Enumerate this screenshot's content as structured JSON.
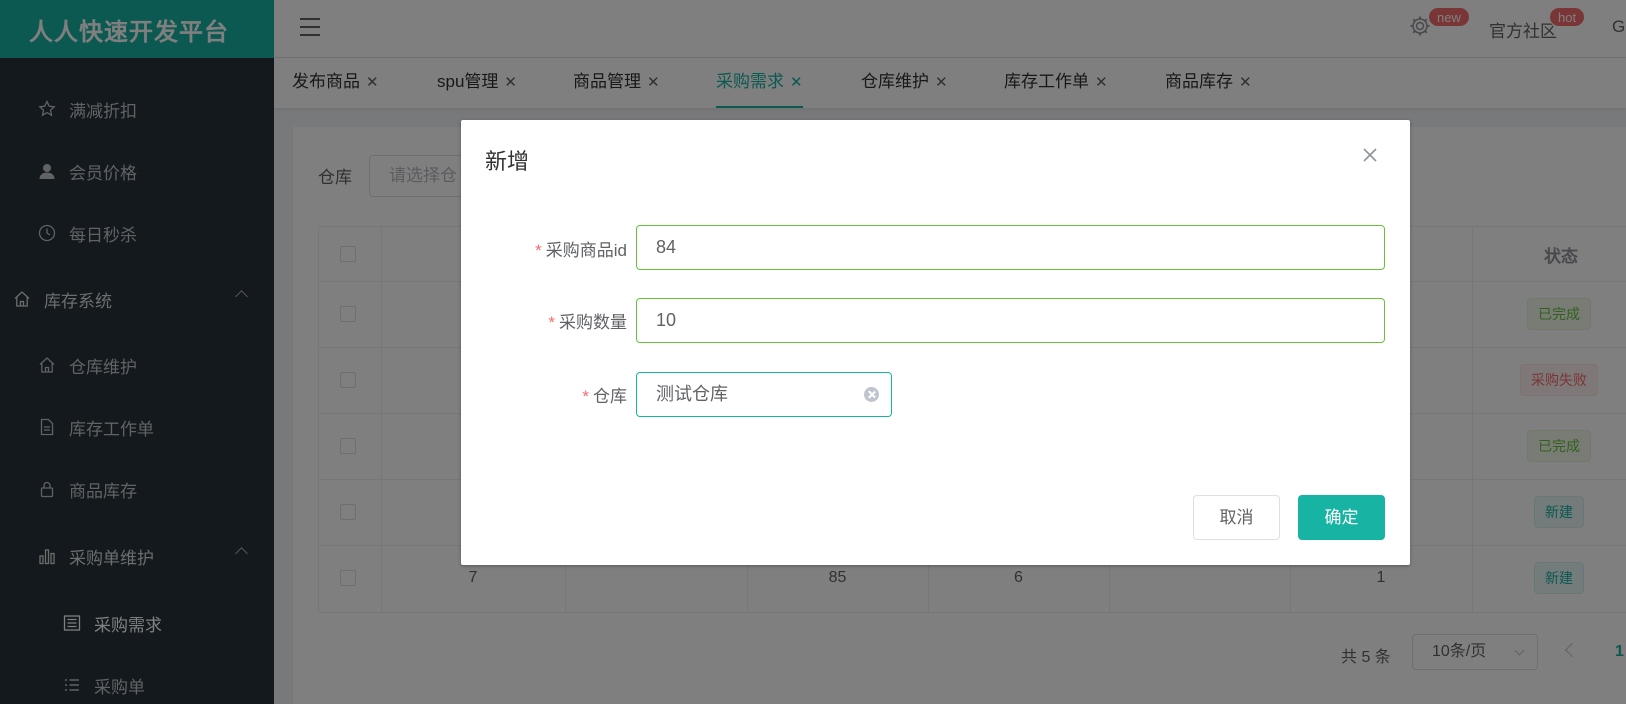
{
  "sidebar": {
    "brand": "人人快速开发平台",
    "items": [
      {
        "label": "满减折扣",
        "icon": "star-icon"
      },
      {
        "label": "会员价格",
        "icon": "user-icon"
      },
      {
        "label": "每日秒杀",
        "icon": "clock-icon"
      },
      {
        "label": "库存系统",
        "icon": "home-icon"
      },
      {
        "label": "仓库维护",
        "icon": "home-icon"
      },
      {
        "label": "库存工作单",
        "icon": "document-icon"
      },
      {
        "label": "商品库存",
        "icon": "lock-icon"
      },
      {
        "label": "采购单维护",
        "icon": "bar-chart-icon"
      },
      {
        "label": "采购需求",
        "icon": "tablet-icon"
      },
      {
        "label": "采购单",
        "icon": "list-icon"
      }
    ]
  },
  "header": {
    "gear_badge": "new",
    "community_label": "官方社区",
    "community_badge": "hot",
    "cut_label": "Gi"
  },
  "tabs": [
    {
      "label": "发布商品",
      "active": false
    },
    {
      "label": "spu管理",
      "active": false
    },
    {
      "label": "商品管理",
      "active": false
    },
    {
      "label": "采购需求",
      "active": true
    },
    {
      "label": "仓库维护",
      "active": false
    },
    {
      "label": "库存工作单",
      "active": false
    },
    {
      "label": "商品库存",
      "active": false
    }
  ],
  "filter": {
    "label": "仓库",
    "placeholder": "请选择仓"
  },
  "table": {
    "status_header": "状态",
    "status_tags": [
      "已完成",
      "采购失败",
      "已完成",
      "新建",
      "新建"
    ],
    "last_row": {
      "c1": "7",
      "c3": "85",
      "c4": "6",
      "c6": "1"
    }
  },
  "pagination": {
    "total": "共 5 条",
    "page_size": "10条/页",
    "current_page": "1"
  },
  "dialog": {
    "title": "新增",
    "fields": [
      {
        "label": "采购商品id",
        "value": "84"
      },
      {
        "label": "采购数量",
        "value": "10"
      },
      {
        "label": "仓库",
        "value": "测试仓库"
      }
    ],
    "cancel": "取消",
    "confirm": "确定"
  },
  "colors": {
    "brand": "#17b3a3",
    "sidebar_bg": "#263238",
    "success": "#67c23a",
    "danger": "#f56c6c"
  }
}
